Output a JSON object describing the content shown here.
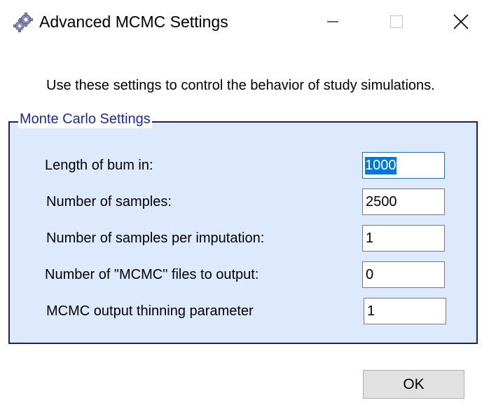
{
  "window": {
    "title": "Advanced MCMC Settings",
    "icon": "gears-icon"
  },
  "description": "Use these settings to control the behavior of study simulations.",
  "group": {
    "legend": "Monte Carlo Settings",
    "fields": [
      {
        "label": "Length of bum in:",
        "value": "1000",
        "focused": true,
        "selected": true
      },
      {
        "label": "Number of samples:",
        "value": "2500"
      },
      {
        "label": "Number of samples per imputation:",
        "value": "1"
      },
      {
        "label": "Number of \"MCMC\" files to output:",
        "value": "0"
      },
      {
        "label": "MCMC output thinning parameter",
        "value": "1"
      }
    ]
  },
  "buttons": {
    "ok_label": "OK"
  },
  "colors": {
    "group_background": "#ddeafe",
    "group_border": "#1f1f66",
    "legend_text": "#1a2aa0",
    "selection": "#0078d7"
  }
}
